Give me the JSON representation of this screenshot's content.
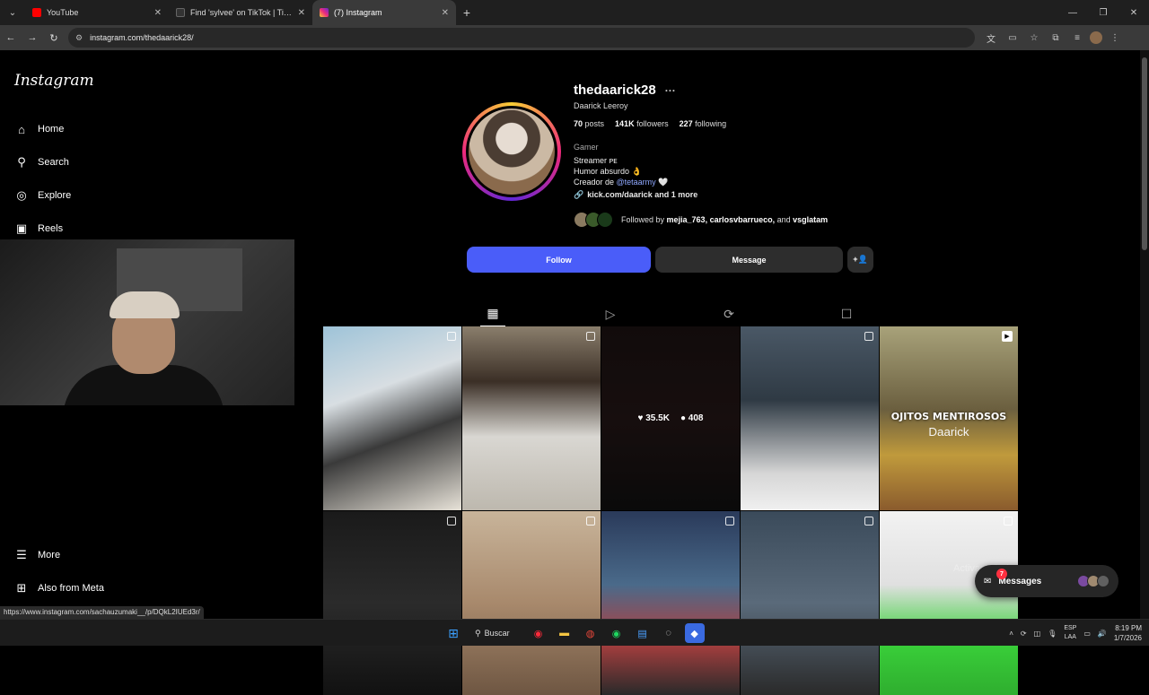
{
  "browser": {
    "tabs": [
      {
        "title": "YouTube",
        "color": "#ff0000",
        "active": false
      },
      {
        "title": "Find 'sylvee' on TikTok | TikTok",
        "color": "#222222",
        "active": false
      },
      {
        "title": "(7) Instagram",
        "color": "#d6249f",
        "active": true
      }
    ],
    "new_tab": "+",
    "url": "instagram.com/thedaarick28/"
  },
  "sidebar": {
    "logo": "Instagram",
    "items": [
      {
        "label": "Home",
        "icon": "home-icon"
      },
      {
        "label": "Search",
        "icon": "search-icon"
      },
      {
        "label": "Explore",
        "icon": "compass-icon"
      },
      {
        "label": "Reels",
        "icon": "reels-icon"
      },
      {
        "label": "More",
        "icon": "menu-icon"
      },
      {
        "label": "Also from Meta",
        "icon": "meta-icon"
      }
    ]
  },
  "profile": {
    "username": "thedaarick28",
    "full_name": "Daarick Leeroy",
    "posts_count": "70",
    "posts_label": "posts",
    "followers_count": "141K",
    "followers_label": "followers",
    "following_count": "227",
    "following_label": "following",
    "category": "Gamer",
    "bio_line1": "Streamer ᴘᴇ",
    "bio_line2": "Humor absurdo 👌",
    "bio_line3_prefix": "Creador de ",
    "bio_mention": "@tetaarmy",
    "bio_line3_suffix": " 🤍",
    "link": "kick.com/daarick and 1 more",
    "followed_by_prefix": "Followed by ",
    "followed_by_names": "mejia_763, carlosvbarrueco,",
    "followed_by_and": " and ",
    "followed_by_last": "vsglatam",
    "follow_button": "Follow",
    "message_button": "Message",
    "suggest_icon": "+👤"
  },
  "post_tabs": [
    "posts-grid-icon",
    "reels-icon",
    "reposts-icon",
    "tagged-icon"
  ],
  "posts": [
    {
      "kind": "multi",
      "bg": "linear-gradient(160deg,#9ec3d8 0%,#d8dee2 35%,#3a3a3a 60%,#e7e2d8 100%)"
    },
    {
      "kind": "multi",
      "bg": "linear-gradient(180deg,#8a7e6c 0%,#3b2f26 30%,#d9d7d2 60%,#bdb8ae 100%)"
    },
    {
      "kind": "hover",
      "likes": "35.5K",
      "comments": "408",
      "bg": "linear-gradient(180deg,#1b1212 0%,#241616 50%,#101010 100%)"
    },
    {
      "kind": "multi",
      "bg": "linear-gradient(180deg,#4a5866 0%,#2f3a44 40%,#d6d6d6 80%,#f0f0f0 100%)"
    },
    {
      "kind": "reel",
      "title": "OJITOS MENTIROSOS",
      "subtitle": "Daarick",
      "bg": "linear-gradient(180deg,#a8a27a 0%,#6b5f3f 45%,#c09a3c 70%,#8a5b2d 100%)"
    },
    {
      "kind": "multi",
      "bg": "linear-gradient(180deg,#1a1a1a 0%,#2b2b2b 50%,#111 100%)"
    },
    {
      "kind": "multi",
      "bg": "linear-gradient(180deg,#c8b49a 0%,#a8896c 50%,#6e5642 100%)"
    },
    {
      "kind": "multi",
      "bg": "linear-gradient(180deg,#2a3a5a 0%,#4a6a8a 40%,#b04040 70%,#2a2a2a 100%)"
    },
    {
      "kind": "multi",
      "bg": "linear-gradient(180deg,#3a4a5a 0%,#5a6a7a 50%,#2a2a2a 100%)"
    },
    {
      "kind": "multi",
      "bg": "linear-gradient(180deg,#f2f2f2 0%,#e0e0e0 40%,#3ad13a 70%,#2fae2f 100%)"
    }
  ],
  "messages": {
    "label": "Messages",
    "badge": "7"
  },
  "watermark": "Activar Windows",
  "status_url": "https://www.instagram.com/sachauzumaki__/p/DQkL2IUEd3r/",
  "taskbar": {
    "search_label": "Buscar",
    "lang_top": "ESP",
    "lang_bottom": "LAA",
    "time": "8:19 PM",
    "date": "1/7/2026"
  }
}
